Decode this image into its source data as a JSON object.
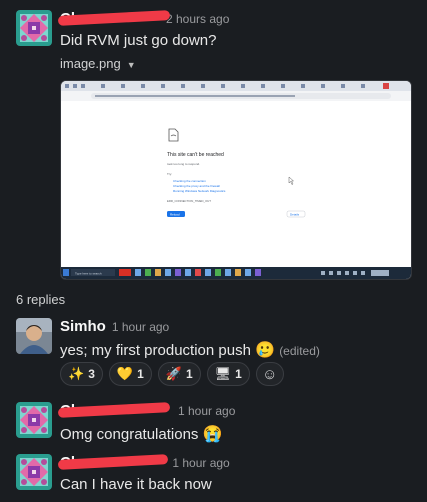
{
  "messages": [
    {
      "name": "Ch",
      "time": "2 hours ago",
      "text": "Did RVM just go down?"
    },
    {
      "name": "Simho",
      "time": "1 hour ago",
      "text": "yes; my first production push",
      "edited": "(edited)"
    },
    {
      "name": "Ch",
      "time": "1 hour ago",
      "text": "Omg congratulations"
    },
    {
      "name": "Cha",
      "time": "1 hour ago",
      "text": "Can I have it back now"
    }
  ],
  "attachment": {
    "filename": "image.png",
    "error_title": "This site can't be reached",
    "error_detail": "took too long to respond.",
    "try_label": "Try:",
    "suggestions": [
      "Checking the connection",
      "Checking the proxy and the firewall",
      "Running Windows Network Diagnostics"
    ],
    "error_code": "ERR_CONNECTION_TIMED_OUT",
    "reload_label": "Reload",
    "details_label": "Details",
    "search_placeholder": "Type here to search"
  },
  "thread": {
    "replies_label": "6 replies"
  },
  "reactions": [
    {
      "emoji": "✨",
      "count": "3"
    },
    {
      "emoji": "💛",
      "count": "1"
    },
    {
      "emoji": "🚀",
      "count": "1"
    },
    {
      "emoji": "🖥",
      "count": "1"
    }
  ],
  "emoji": {
    "smile_tear": "🥲",
    "crying": "😭",
    "add_reaction": "☺"
  }
}
